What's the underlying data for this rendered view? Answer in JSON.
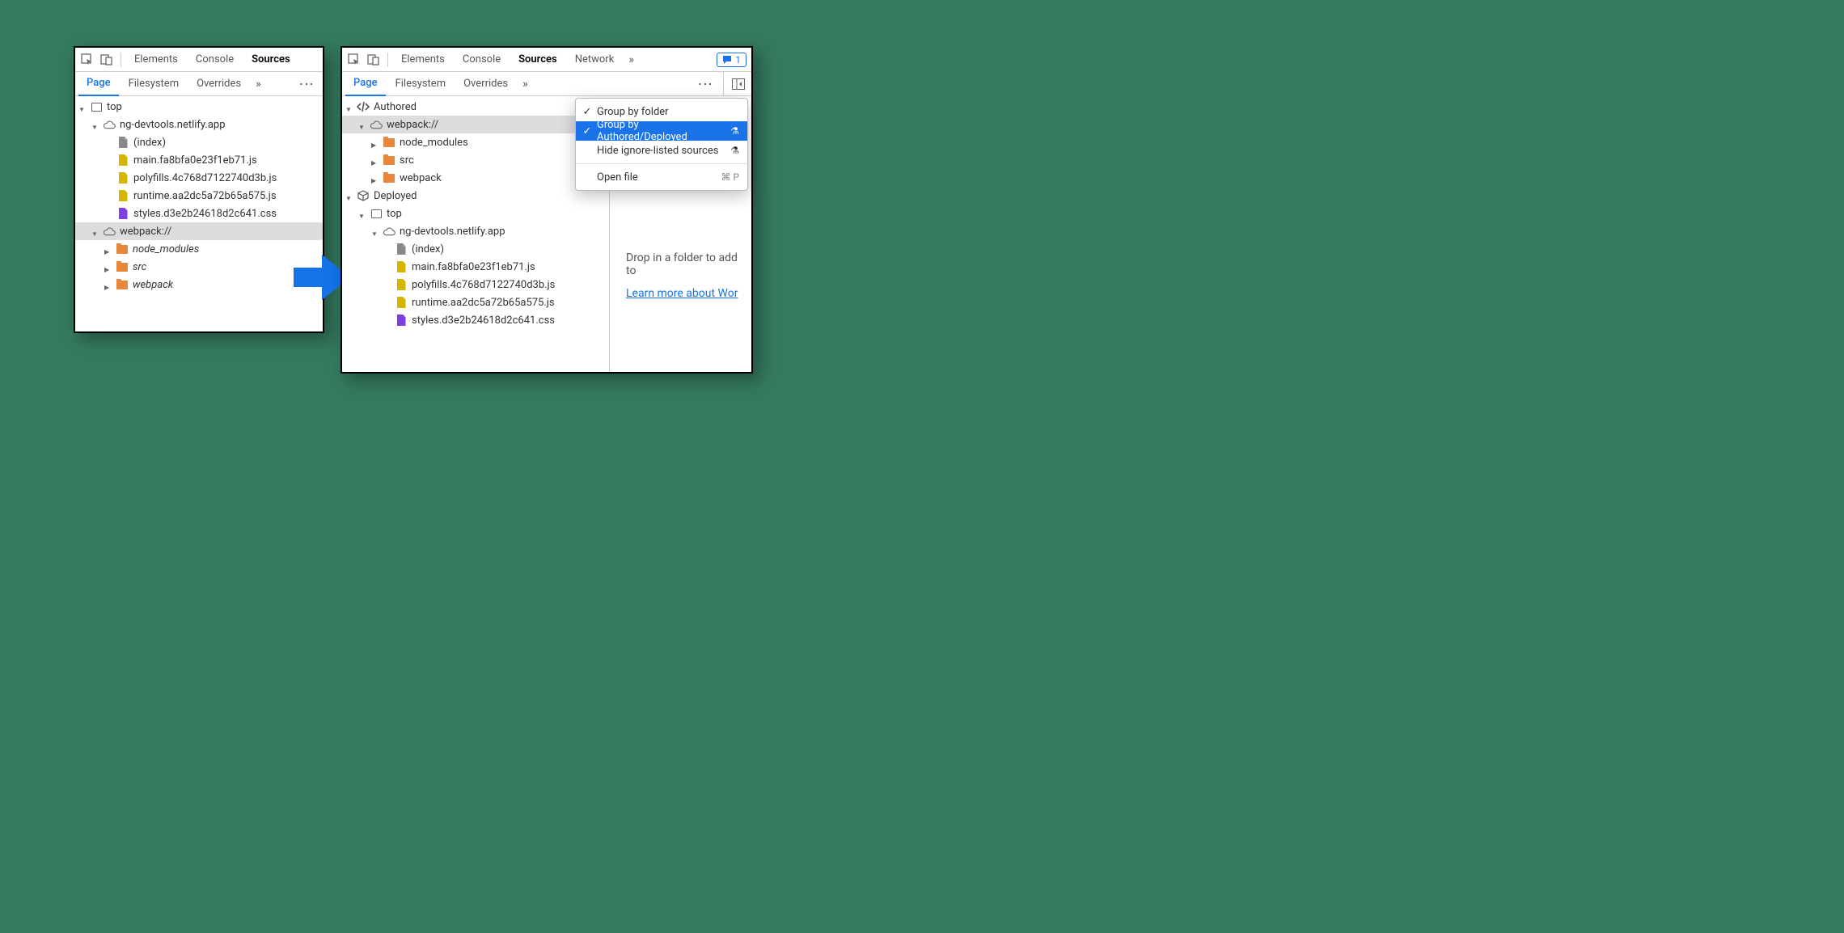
{
  "tabs": {
    "elements": "Elements",
    "console": "Console",
    "sources": "Sources",
    "network": "Network",
    "more": "»"
  },
  "issues_badge": {
    "count": "1"
  },
  "subtabs": {
    "page": "Page",
    "filesystem": "Filesystem",
    "overrides": "Overrides",
    "more": "»",
    "kebab": "⋮"
  },
  "left_tree": {
    "top": "top",
    "domain": "ng-devtools.netlify.app",
    "index": "(index)",
    "files": [
      "main.fa8bfa0e23f1eb71.js",
      "polyfills.4c768d7122740d3b.js",
      "runtime.aa2dc5a72b65a575.js",
      "styles.d3e2b24618d2c641.css"
    ],
    "webpack": "webpack://",
    "folders": [
      "node_modules",
      "src",
      "webpack"
    ]
  },
  "right_tree": {
    "authored": "Authored",
    "webpack": "webpack://",
    "folders": [
      "node_modules",
      "src",
      "webpack"
    ],
    "deployed": "Deployed",
    "top": "top",
    "domain": "ng-devtools.netlify.app",
    "index": "(index)",
    "files": [
      "main.fa8bfa0e23f1eb71.js",
      "polyfills.4c768d7122740d3b.js",
      "runtime.aa2dc5a72b65a575.js",
      "styles.d3e2b24618d2c641.css"
    ]
  },
  "context_menu": {
    "group_folder": "Group by folder",
    "group_authored": "Group by Authored/Deployed",
    "hide_ignore": "Hide ignore-listed sources",
    "open_file": "Open file",
    "open_file_shortcut": "⌘ P"
  },
  "workspace": {
    "drop_text": "Drop in a folder to add to",
    "learn_more": "Learn more about Wor"
  }
}
